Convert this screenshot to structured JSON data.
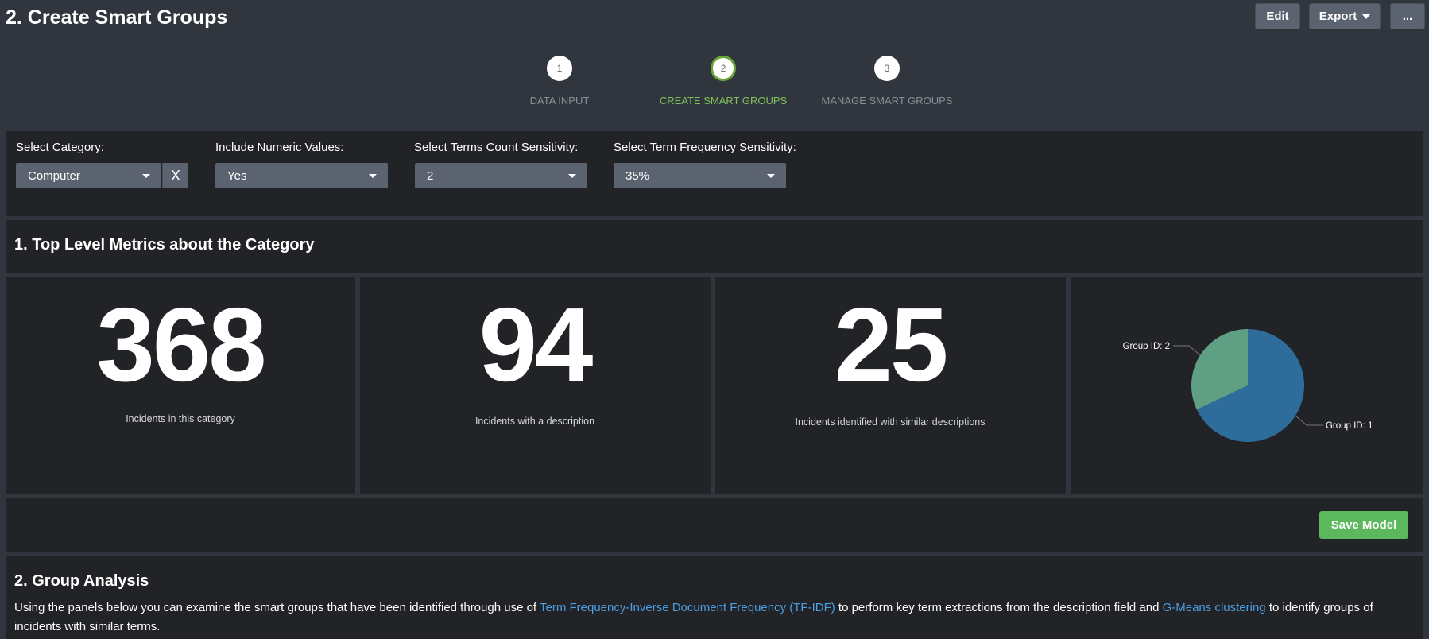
{
  "header": {
    "title": "2. Create Smart Groups",
    "buttons": {
      "edit": "Edit",
      "export": "Export",
      "more": "..."
    }
  },
  "steps": [
    {
      "number": "1",
      "label": "DATA INPUT",
      "active": false
    },
    {
      "number": "2",
      "label": "CREATE SMART GROUPS",
      "active": true
    },
    {
      "number": "3",
      "label": "MANAGE SMART GROUPS",
      "active": false
    }
  ],
  "filters": {
    "category": {
      "label": "Select Category:",
      "value": "Computer",
      "clear": "X"
    },
    "numeric": {
      "label": "Include Numeric Values:",
      "value": "Yes"
    },
    "terms_count": {
      "label": "Select Terms Count Sensitivity:",
      "value": "2"
    },
    "term_frequency": {
      "label": "Select Term Frequency Sensitivity:",
      "value": "35%"
    }
  },
  "metrics": {
    "title": "1. Top Level Metrics about the Category",
    "items": [
      {
        "value": "368",
        "label": "Incidents in this category"
      },
      {
        "value": "94",
        "label": "Incidents with a description"
      },
      {
        "value": "25",
        "label": "Incidents identified with similar descriptions"
      }
    ]
  },
  "save_button": "Save Model",
  "group_analysis": {
    "title": "2. Group Analysis",
    "text_1": "Using the panels below you can examine the smart groups that have been identified through use of ",
    "link_1": "Term Frequency-Inverse Document Frequency (TF-IDF)",
    "text_2": " to perform key term extractions from the description field and ",
    "link_2": "G-Means clustering",
    "text_3": " to identify groups of incidents with similar terms."
  },
  "colors": {
    "accent_green": "#65a637",
    "link_blue": "#4b9fe3",
    "save_green": "#5cb85c"
  },
  "chart_data": {
    "type": "pie",
    "title": "",
    "slices": [
      {
        "label": "Group ID: 1",
        "value": 17,
        "color": "#2e6d9b"
      },
      {
        "label": "Group ID: 2",
        "value": 8,
        "color": "#5fa084"
      }
    ]
  }
}
